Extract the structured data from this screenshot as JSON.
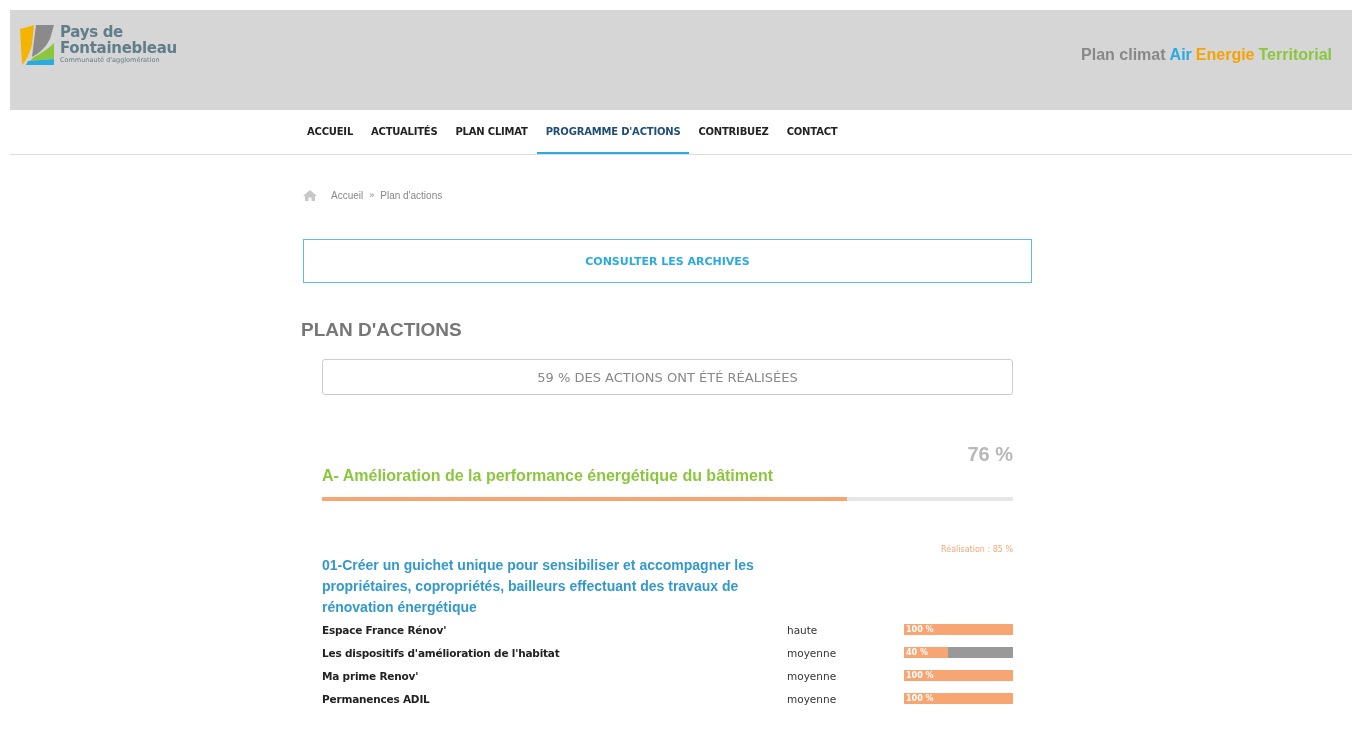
{
  "header": {
    "logo": {
      "line1": "Pays de",
      "line2": "Fontainebleau",
      "tagline": "Communauté d'agglomération"
    },
    "title_parts": [
      {
        "text": "Plan climat",
        "color": "#888888"
      },
      {
        "text": "Air",
        "color": "#29abe2"
      },
      {
        "text": "Energie",
        "color": "#f5a300"
      },
      {
        "text": "Territorial",
        "color": "#8cc63f"
      }
    ]
  },
  "nav": [
    {
      "label": "ACCUEIL",
      "selected": false
    },
    {
      "label": "ACTUALITÉS",
      "selected": false
    },
    {
      "label": "PLAN CLIMAT",
      "selected": false
    },
    {
      "label": "PROGRAMME D'ACTIONS",
      "selected": true
    },
    {
      "label": "CONTRIBUEZ",
      "selected": false
    },
    {
      "label": "CONTACT",
      "selected": false
    }
  ],
  "breadcrumb": [
    "Accueil",
    "»",
    "Plan d'actions"
  ],
  "archives_button": "CONSULTER LES ARCHIVES",
  "page_title": "PLAN D'ACTIONS",
  "summary": "59 % DES ACTIONS ONT ÉTÉ RÉALISÉES",
  "sections": [
    {
      "percent": "76 %",
      "title": "A- Amélioration de la performance énergétique du bâtiment",
      "level": 0.76,
      "actions": [
        {
          "realisation": "Réalisation : 85 %",
          "title": "01-Créer un guichet unique pour sensibiliser et accompagner les propriétaires, copropriétés, bailleurs effectuant des travaux de rénovation énergétique",
          "items": [
            {
              "name": "Espace France Rénov'",
              "priority": "haute",
              "level": 1,
              "reading": "100 %"
            },
            {
              "name": "Les dispositifs d'amélioration de l'habitat",
              "priority": "moyenne",
              "level": 0.4,
              "reading": "40 %"
            },
            {
              "name": "Ma prime Renov'",
              "priority": "moyenne",
              "level": 1,
              "reading": "100 %"
            },
            {
              "name": "Permanences ADIL",
              "priority": "moyenne",
              "level": 1,
              "reading": "100 %"
            }
          ]
        }
      ]
    }
  ]
}
